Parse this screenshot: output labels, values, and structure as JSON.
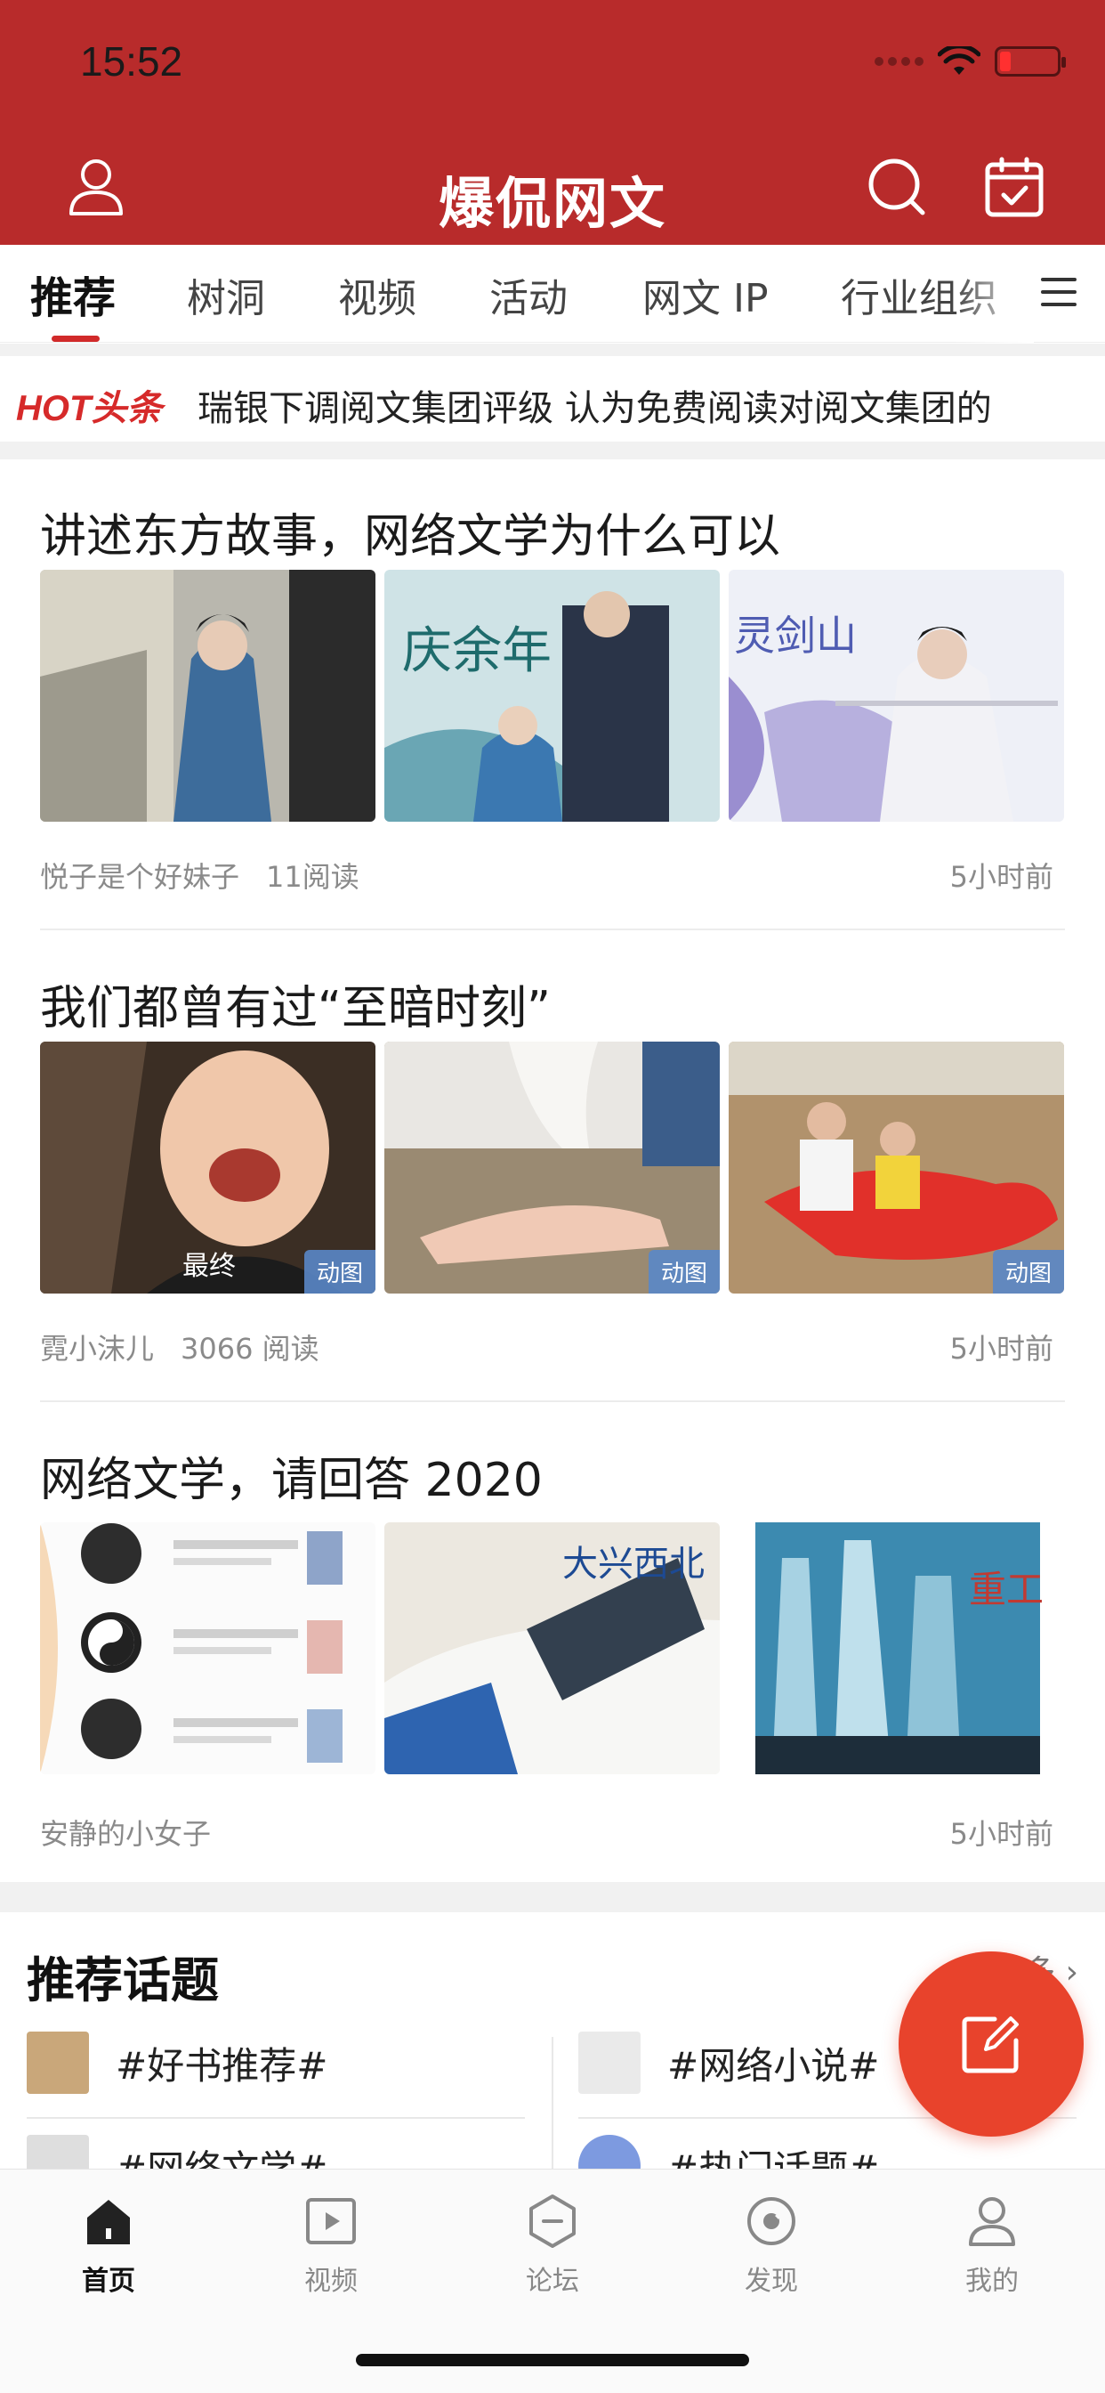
{
  "status_bar": {
    "time": "15:52"
  },
  "header": {
    "logo": "爆侃网文"
  },
  "tabs": [
    {
      "label": "推荐",
      "active": true
    },
    {
      "label": "树洞"
    },
    {
      "label": "视频"
    },
    {
      "label": "活动"
    },
    {
      "label": "网文 IP"
    },
    {
      "label": "行业组织"
    }
  ],
  "hot": {
    "badge": "HOT头条",
    "headline": "瑞银下调阅文集团评级 认为免费阅读对阅文集团的"
  },
  "articles": [
    {
      "title": "讲述东方故事，网络文学为什么可以",
      "author": "悦子是个好妹子",
      "reads": "11阅读",
      "time": "5小时前",
      "thumb_gif_labels": [
        "",
        "",
        ""
      ],
      "thumb_texts": [
        "",
        "庆余年",
        "灵剑山"
      ]
    },
    {
      "title": "我们都曾有过“至暗时刻”",
      "author": "霓小沫儿",
      "reads": "3066 阅读",
      "time": "5小时前",
      "thumb_gif_labels": [
        "动图",
        "动图",
        "动图"
      ],
      "thumb_texts": [
        "最终",
        "",
        ""
      ]
    },
    {
      "title": "网络文学，请回答 2020",
      "author": "安静的小女子",
      "reads": "",
      "time": "5小时前",
      "thumb_gif_labels": [
        "",
        "",
        ""
      ],
      "thumb_texts": [
        "",
        "大兴西北",
        "重工"
      ]
    }
  ],
  "topics": {
    "title": "推荐话题",
    "more": "更多",
    "items": [
      {
        "label": "#好书推荐#"
      },
      {
        "label": "#网络小说#"
      },
      {
        "label": "#网络文学#"
      },
      {
        "label": "#热门话题#"
      }
    ]
  },
  "bottom_nav": [
    {
      "label": "首页",
      "icon": "home-icon",
      "active": true
    },
    {
      "label": "视频",
      "icon": "video-icon"
    },
    {
      "label": "论坛",
      "icon": "forum-icon"
    },
    {
      "label": "发现",
      "icon": "discover-icon"
    },
    {
      "label": "我的",
      "icon": "profile-icon"
    }
  ],
  "colors": {
    "brand_red": "#b82b2b",
    "accent_red": "#e8432c",
    "gif_badge": "#5a87c8"
  }
}
